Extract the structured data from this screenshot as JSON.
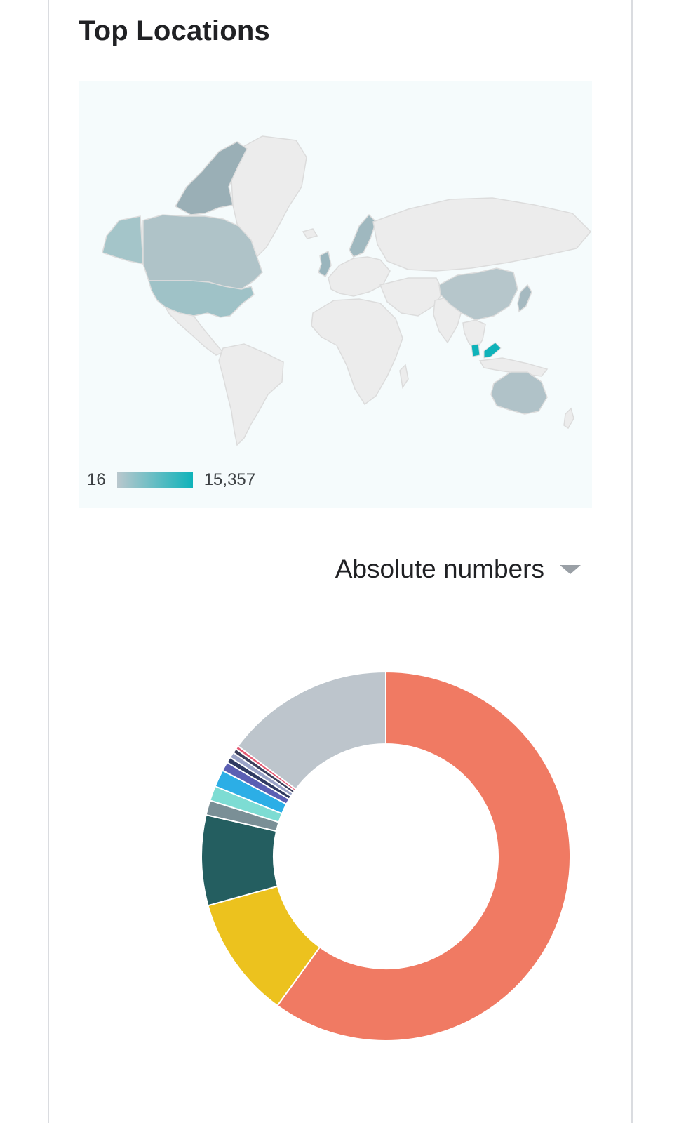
{
  "card": {
    "title": "Top Locations"
  },
  "map": {
    "legend_min": "16",
    "legend_max": "15,357",
    "scale_colors": [
      "#b9c7cd",
      "#0fb3ba"
    ],
    "highlighted_regions": [
      {
        "name": "Malaysia",
        "color": "#0fb3ba"
      },
      {
        "name": "United States",
        "color": "#9fc2c7"
      },
      {
        "name": "Canada",
        "color": "#afc3c8"
      },
      {
        "name": "United Kingdom",
        "color": "#9ab5bd"
      },
      {
        "name": "China",
        "color": "#b6c6cb"
      },
      {
        "name": "Australia",
        "color": "#b0c2c8"
      },
      {
        "name": "Japan",
        "color": "#a5b9c0"
      }
    ]
  },
  "selector": {
    "label": "Absolute numbers",
    "icon": "caret-down-icon"
  },
  "chart_data": {
    "type": "pie",
    "categories": [
      "",
      "",
      "",
      "",
      "",
      "",
      "",
      "",
      "",
      "",
      "",
      ""
    ],
    "values": [
      60.0,
      10.7,
      7.9,
      1.3,
      1.3,
      1.5,
      0.8,
      0.5,
      0.5,
      0.4,
      0.3,
      14.8
    ],
    "colors": [
      "#f07a63",
      "#ecc21e",
      "#245e60",
      "#7a8f96",
      "#7ddcd3",
      "#2caee6",
      "#5b5fb3",
      "#2f3a62",
      "#9aa3c7",
      "#3b3f5c",
      "#e55a73",
      "#bdc5cc"
    ],
    "donut": true,
    "title": ""
  }
}
